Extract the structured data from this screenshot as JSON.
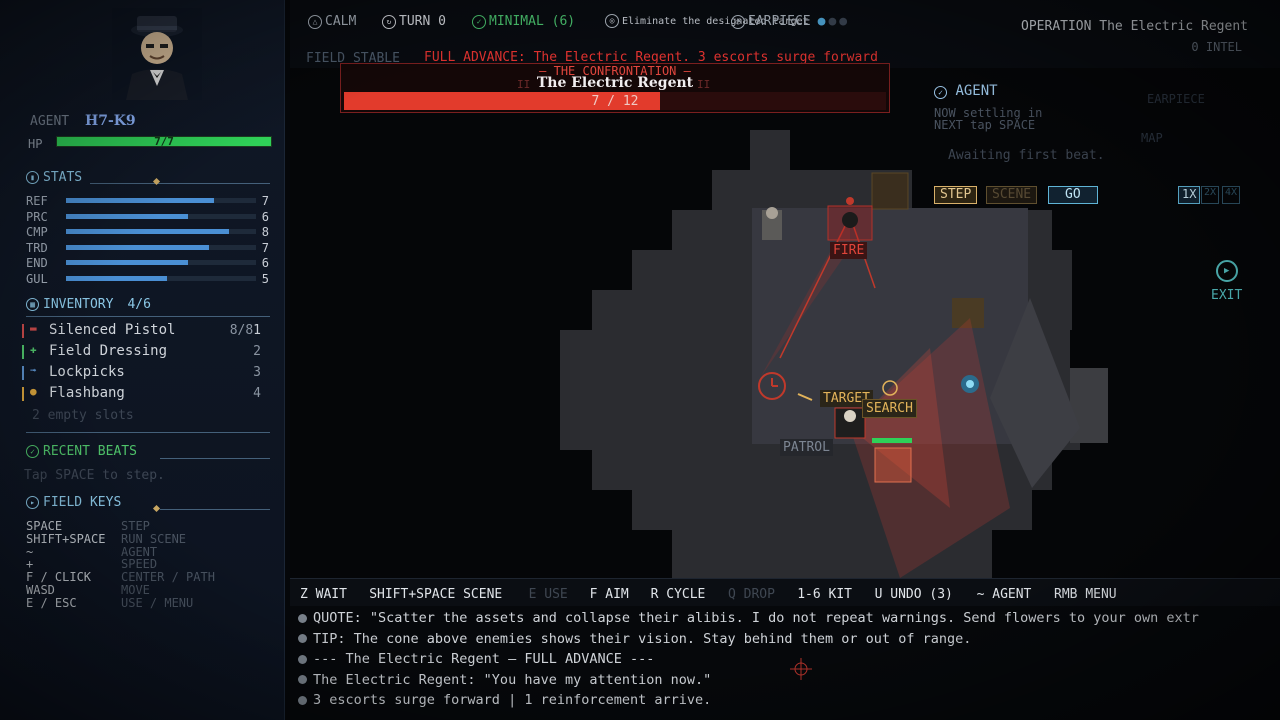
{
  "status": {
    "mood": "CALM",
    "turn": "TURN 0",
    "noise": "MINIMAL (6)",
    "objective": "Eliminate the designated target",
    "earpiece": "EARPIECE"
  },
  "operation": {
    "title": "OPERATION The Electric Regent",
    "intel": "0 INTEL"
  },
  "alerts": {
    "field": "FIELD STABLE",
    "advance": "FULL ADVANCE: The Electric Regent. 3 escorts surge forward"
  },
  "boss": {
    "header": "— THE CONFRONTATION —",
    "name": "The Electric Regent",
    "hp_text": "7 / 12",
    "hp_fraction": 0.5833,
    "phase_ticks": [
      "II",
      "II"
    ]
  },
  "agent": {
    "label": "AGENT",
    "id": "H7-K9",
    "hp_label": "HP",
    "hp_text": "7/7",
    "hp_fraction": 1.0
  },
  "stats": {
    "title": "STATS",
    "rows": [
      {
        "label": "REF",
        "value": "7",
        "fraction": 0.78
      },
      {
        "label": "PRC",
        "value": "6",
        "fraction": 0.64
      },
      {
        "label": "CMP",
        "value": "8",
        "fraction": 0.86
      },
      {
        "label": "TRD",
        "value": "7",
        "fraction": 0.75
      },
      {
        "label": "END",
        "value": "6",
        "fraction": 0.64
      },
      {
        "label": "GUL",
        "value": "5",
        "fraction": 0.53
      }
    ]
  },
  "inventory": {
    "title": "INVENTORY",
    "count": "4/6",
    "items": [
      {
        "name": "Silenced Pistol",
        "count": "8/8",
        "extra": "1",
        "color": "#c94a4a",
        "icon": "pistol-icon"
      },
      {
        "name": "Field Dressing",
        "count": "2",
        "color": "#4fc36a",
        "icon": "plus-icon"
      },
      {
        "name": "Lockpicks",
        "count": "3",
        "color": "#5a8fc9",
        "icon": "lockpick-icon"
      },
      {
        "name": "Flashbang",
        "count": "4",
        "color": "#d6a23c",
        "icon": "grenade-icon"
      }
    ],
    "empty": "2 empty slots"
  },
  "recent_beats": {
    "title": "RECENT BEATS",
    "hint": "Tap SPACE to step."
  },
  "field_keys": {
    "title": "FIELD KEYS",
    "rows": [
      {
        "key": "SPACE",
        "action": "STEP"
      },
      {
        "key": "SHIFT+SPACE",
        "action": "RUN SCENE"
      },
      {
        "key": "~",
        "action": "AGENT"
      },
      {
        "key": "+",
        "action": "SPEED"
      },
      {
        "key": "F / CLICK",
        "action": "CENTER / PATH"
      },
      {
        "key": "WASD",
        "action": "MOVE"
      },
      {
        "key": "E / ESC",
        "action": "USE / MENU"
      }
    ]
  },
  "map_tags": {
    "fire": "FIRE",
    "target": "TARGET",
    "search": "SEARCH",
    "patrol": "PATROL"
  },
  "agent_panel": {
    "title": "AGENT",
    "now": "NOW   settling in",
    "next": "NEXT  tap SPACE",
    "waiting": "Awaiting first beat.",
    "buttons": {
      "step": "STEP",
      "scene": "SCENE",
      "go": "GO"
    },
    "speeds": [
      "1X",
      "2X",
      "4X"
    ],
    "exit": "EXIT"
  },
  "ghost": {
    "earpiece": "EARPIECE",
    "map": "MAP"
  },
  "keybar": [
    {
      "key": "Z",
      "action": "WAIT",
      "enabled": true
    },
    {
      "key": "SHIFT+SPACE",
      "action": "SCENE",
      "enabled": true
    },
    {
      "key": "E",
      "action": "USE",
      "enabled": false
    },
    {
      "key": "F",
      "action": "AIM",
      "enabled": true
    },
    {
      "key": "R",
      "action": "CYCLE",
      "enabled": true
    },
    {
      "key": "Q",
      "action": "DROP",
      "enabled": false
    },
    {
      "key": "1-6",
      "action": "KIT",
      "enabled": true
    },
    {
      "key": "U",
      "action": "UNDO (3)",
      "enabled": true
    },
    {
      "key": "~",
      "action": "AGENT",
      "enabled": true
    },
    {
      "key": "RMB",
      "action": "MENU",
      "enabled": true
    }
  ],
  "log": [
    "QUOTE: \"Scatter the assets and collapse their alibis. I do not repeat warnings. Send flowers to your own extr",
    "TIP: The cone above enemies shows their vision. Stay behind them or out of range.",
    "--- The Electric Regent — FULL ADVANCE ---",
    "The Electric Regent: \"You have my attention now.\"",
    "3 escorts surge forward | 1 reinforcement arrive."
  ],
  "colors": {
    "accent": "#8cc9e8",
    "hp_green": "#2fd158",
    "danger": "#e23b2c",
    "stat_blue": "#4a8fd4",
    "search_gold": "#e2b35a"
  }
}
